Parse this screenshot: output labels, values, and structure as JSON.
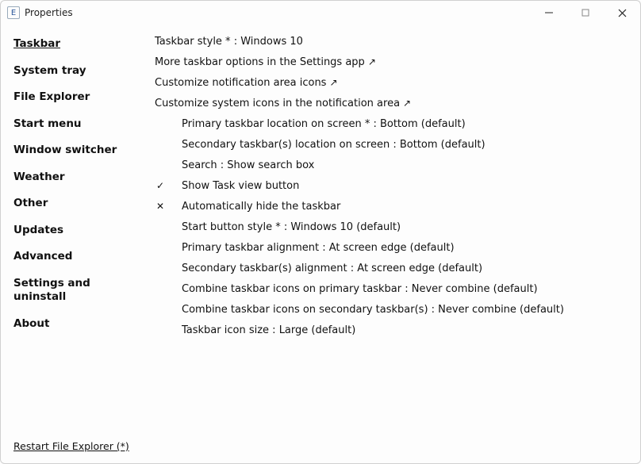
{
  "window": {
    "title": "Properties"
  },
  "sidebar": {
    "items": [
      {
        "label": "Taskbar",
        "selected": true
      },
      {
        "label": "System tray"
      },
      {
        "label": "File Explorer"
      },
      {
        "label": "Start menu"
      },
      {
        "label": "Window switcher"
      },
      {
        "label": "Weather"
      },
      {
        "label": "Other"
      },
      {
        "label": "Updates"
      },
      {
        "label": "Advanced"
      },
      {
        "label": "Settings and uninstall"
      },
      {
        "label": "About"
      }
    ]
  },
  "content": {
    "top_rows": [
      {
        "label": "Taskbar style * : Windows 10",
        "link": false
      },
      {
        "label": "More taskbar options in the Settings app",
        "link": true
      },
      {
        "label": "Customize notification area icons",
        "link": true
      },
      {
        "label": "Customize system icons in the notification area",
        "link": true
      }
    ],
    "sub_rows": [
      {
        "state": "",
        "label": "Primary taskbar location on screen * : Bottom (default)"
      },
      {
        "state": "",
        "label": "Secondary taskbar(s) location on screen : Bottom (default)"
      },
      {
        "state": "",
        "label": "Search : Show search box"
      },
      {
        "state": "check",
        "label": "Show Task view button"
      },
      {
        "state": "cross",
        "label": "Automatically hide the taskbar"
      },
      {
        "state": "",
        "label": "Start button style * : Windows 10 (default)"
      },
      {
        "state": "",
        "label": "Primary taskbar alignment : At screen edge (default)"
      },
      {
        "state": "",
        "label": "Secondary taskbar(s) alignment : At screen edge (default)"
      },
      {
        "state": "",
        "label": "Combine taskbar icons on primary taskbar : Never combine (default)"
      },
      {
        "state": "",
        "label": "Combine taskbar icons on secondary taskbar(s) : Never combine (default)"
      },
      {
        "state": "",
        "label": "Taskbar icon size : Large (default)"
      }
    ]
  },
  "icons": {
    "arrow": "↗",
    "check": "✓",
    "cross": "✕"
  },
  "footer": {
    "restart_label": "Restart File Explorer (*)"
  }
}
